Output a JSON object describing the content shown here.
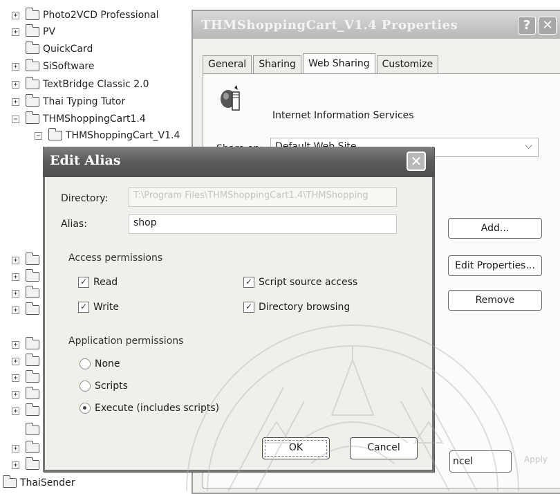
{
  "tree": {
    "items": [
      {
        "label": "Photo2VCD Professional",
        "expander": "+"
      },
      {
        "label": "PV",
        "expander": "+"
      },
      {
        "label": "QuickCard",
        "expander": ""
      },
      {
        "label": "SiSoftware",
        "expander": "+"
      },
      {
        "label": "TextBridge Classic 2.0",
        "expander": "+"
      },
      {
        "label": "Thai Typing Tutor",
        "expander": "+"
      },
      {
        "label": "THMShoppingCart1.4",
        "expander": "−"
      },
      {
        "label": "THMShoppingCart_V1.4",
        "expander": "−"
      },
      {
        "label": "ThaiSender",
        "expander": ""
      }
    ],
    "collapsed_expanders": [
      "+",
      "+",
      "+",
      "+",
      "+",
      "+",
      "+",
      "+",
      "+",
      "+",
      "+",
      "+"
    ]
  },
  "properties": {
    "title": "THMShoppingCart_V1.4 Properties",
    "help_label": "?",
    "close_label": "✕",
    "tabs": [
      {
        "label": "General",
        "active": false
      },
      {
        "label": "Sharing",
        "active": false
      },
      {
        "label": "Web Sharing",
        "active": true
      },
      {
        "label": "Customize",
        "active": false
      }
    ],
    "iis_label": "Internet Information Services",
    "share_on_label": "Share on:",
    "share_on_value": "Default Web Site",
    "add_button": "Add...",
    "edit_properties_button": "Edit Properties...",
    "remove_button": "Remove",
    "cancel_button": "ncel",
    "apply_button": "Apply"
  },
  "dialog": {
    "title": "Edit Alias",
    "close_label": "✕",
    "directory_label": "Directory:",
    "directory_value": "T:\\Program Files\\THMShoppingCart1.4\\THMShopping",
    "alias_label": "Alias:",
    "alias_value": "shop",
    "access_permissions_label": "Access permissions",
    "access": [
      {
        "label": "Read",
        "checked": true
      },
      {
        "label": "Write",
        "checked": true
      },
      {
        "label": "Script source access",
        "checked": true
      },
      {
        "label": "Directory browsing",
        "checked": true
      }
    ],
    "app_permissions_label": "Application permissions",
    "app_permissions": [
      {
        "label": "None",
        "selected": false
      },
      {
        "label": "Scripts",
        "selected": false
      },
      {
        "label": "Execute (includes scripts)",
        "selected": true
      }
    ],
    "ok_button": "OK",
    "cancel_button": "Cancel"
  }
}
